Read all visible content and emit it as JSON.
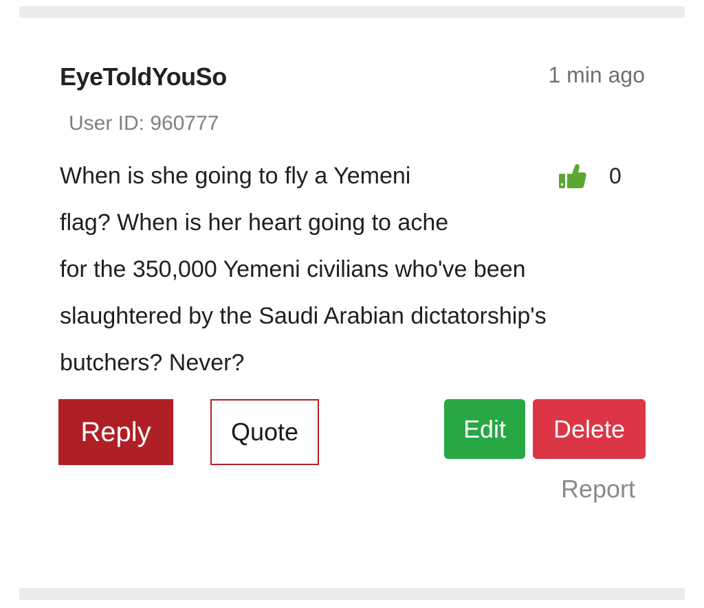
{
  "comment": {
    "username": "EyeToldYouSo",
    "timestamp": "1 min ago",
    "user_id_text": "User ID: 960777",
    "body_lines": [
      "When is she going to fly a Yemeni",
      "flag? When is her heart going to ache",
      "for the 350,000 Yemeni civilians who've been",
      "slaughtered by the Saudi Arabian dictatorship's",
      "butchers? Never?"
    ],
    "likes": {
      "icon": "thumbs-up-icon",
      "count": "0",
      "color": "#5aa832"
    }
  },
  "actions": {
    "reply_label": "Reply",
    "quote_label": "Quote",
    "edit_label": "Edit",
    "delete_label": "Delete",
    "report_label": "Report"
  },
  "colors": {
    "reply_bg": "#b01f26",
    "edit_bg": "#28a745",
    "delete_bg": "#dc3545"
  }
}
